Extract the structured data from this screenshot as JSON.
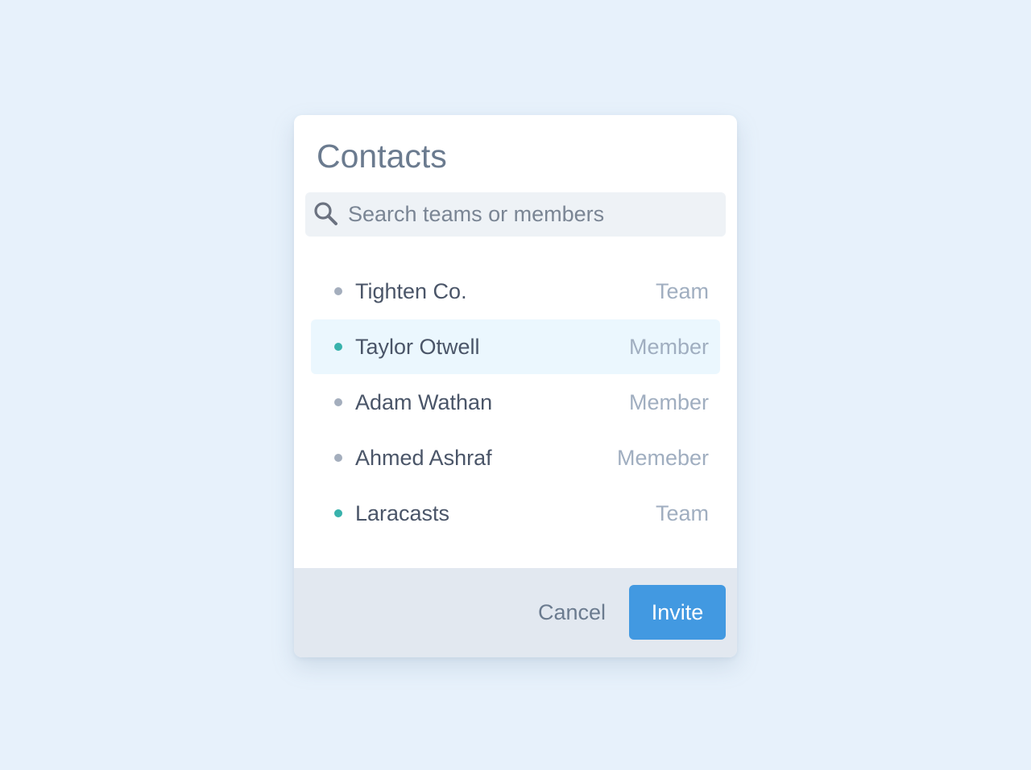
{
  "dialog": {
    "title": "Contacts"
  },
  "search": {
    "placeholder": "Search teams or members",
    "value": "",
    "icon": "search-icon"
  },
  "contacts": [
    {
      "name": "Tighten Co.",
      "type": "Team",
      "status": "offline",
      "selected": false
    },
    {
      "name": "Taylor Otwell",
      "type": "Member",
      "status": "online",
      "selected": true
    },
    {
      "name": "Adam Wathan",
      "type": "Member",
      "status": "offline",
      "selected": false
    },
    {
      "name": "Ahmed Ashraf",
      "type": "Memeber",
      "status": "offline",
      "selected": false
    },
    {
      "name": "Laracasts",
      "type": "Team",
      "status": "online",
      "selected": false
    }
  ],
  "footer": {
    "cancel_label": "Cancel",
    "invite_label": "Invite"
  },
  "colors": {
    "background": "#e7f1fb",
    "accent": "#4299e1",
    "online": "#38b2ac",
    "offline": "#a4aebd",
    "selected_row": "#ebf7fe",
    "footer": "#e2e8f0"
  }
}
